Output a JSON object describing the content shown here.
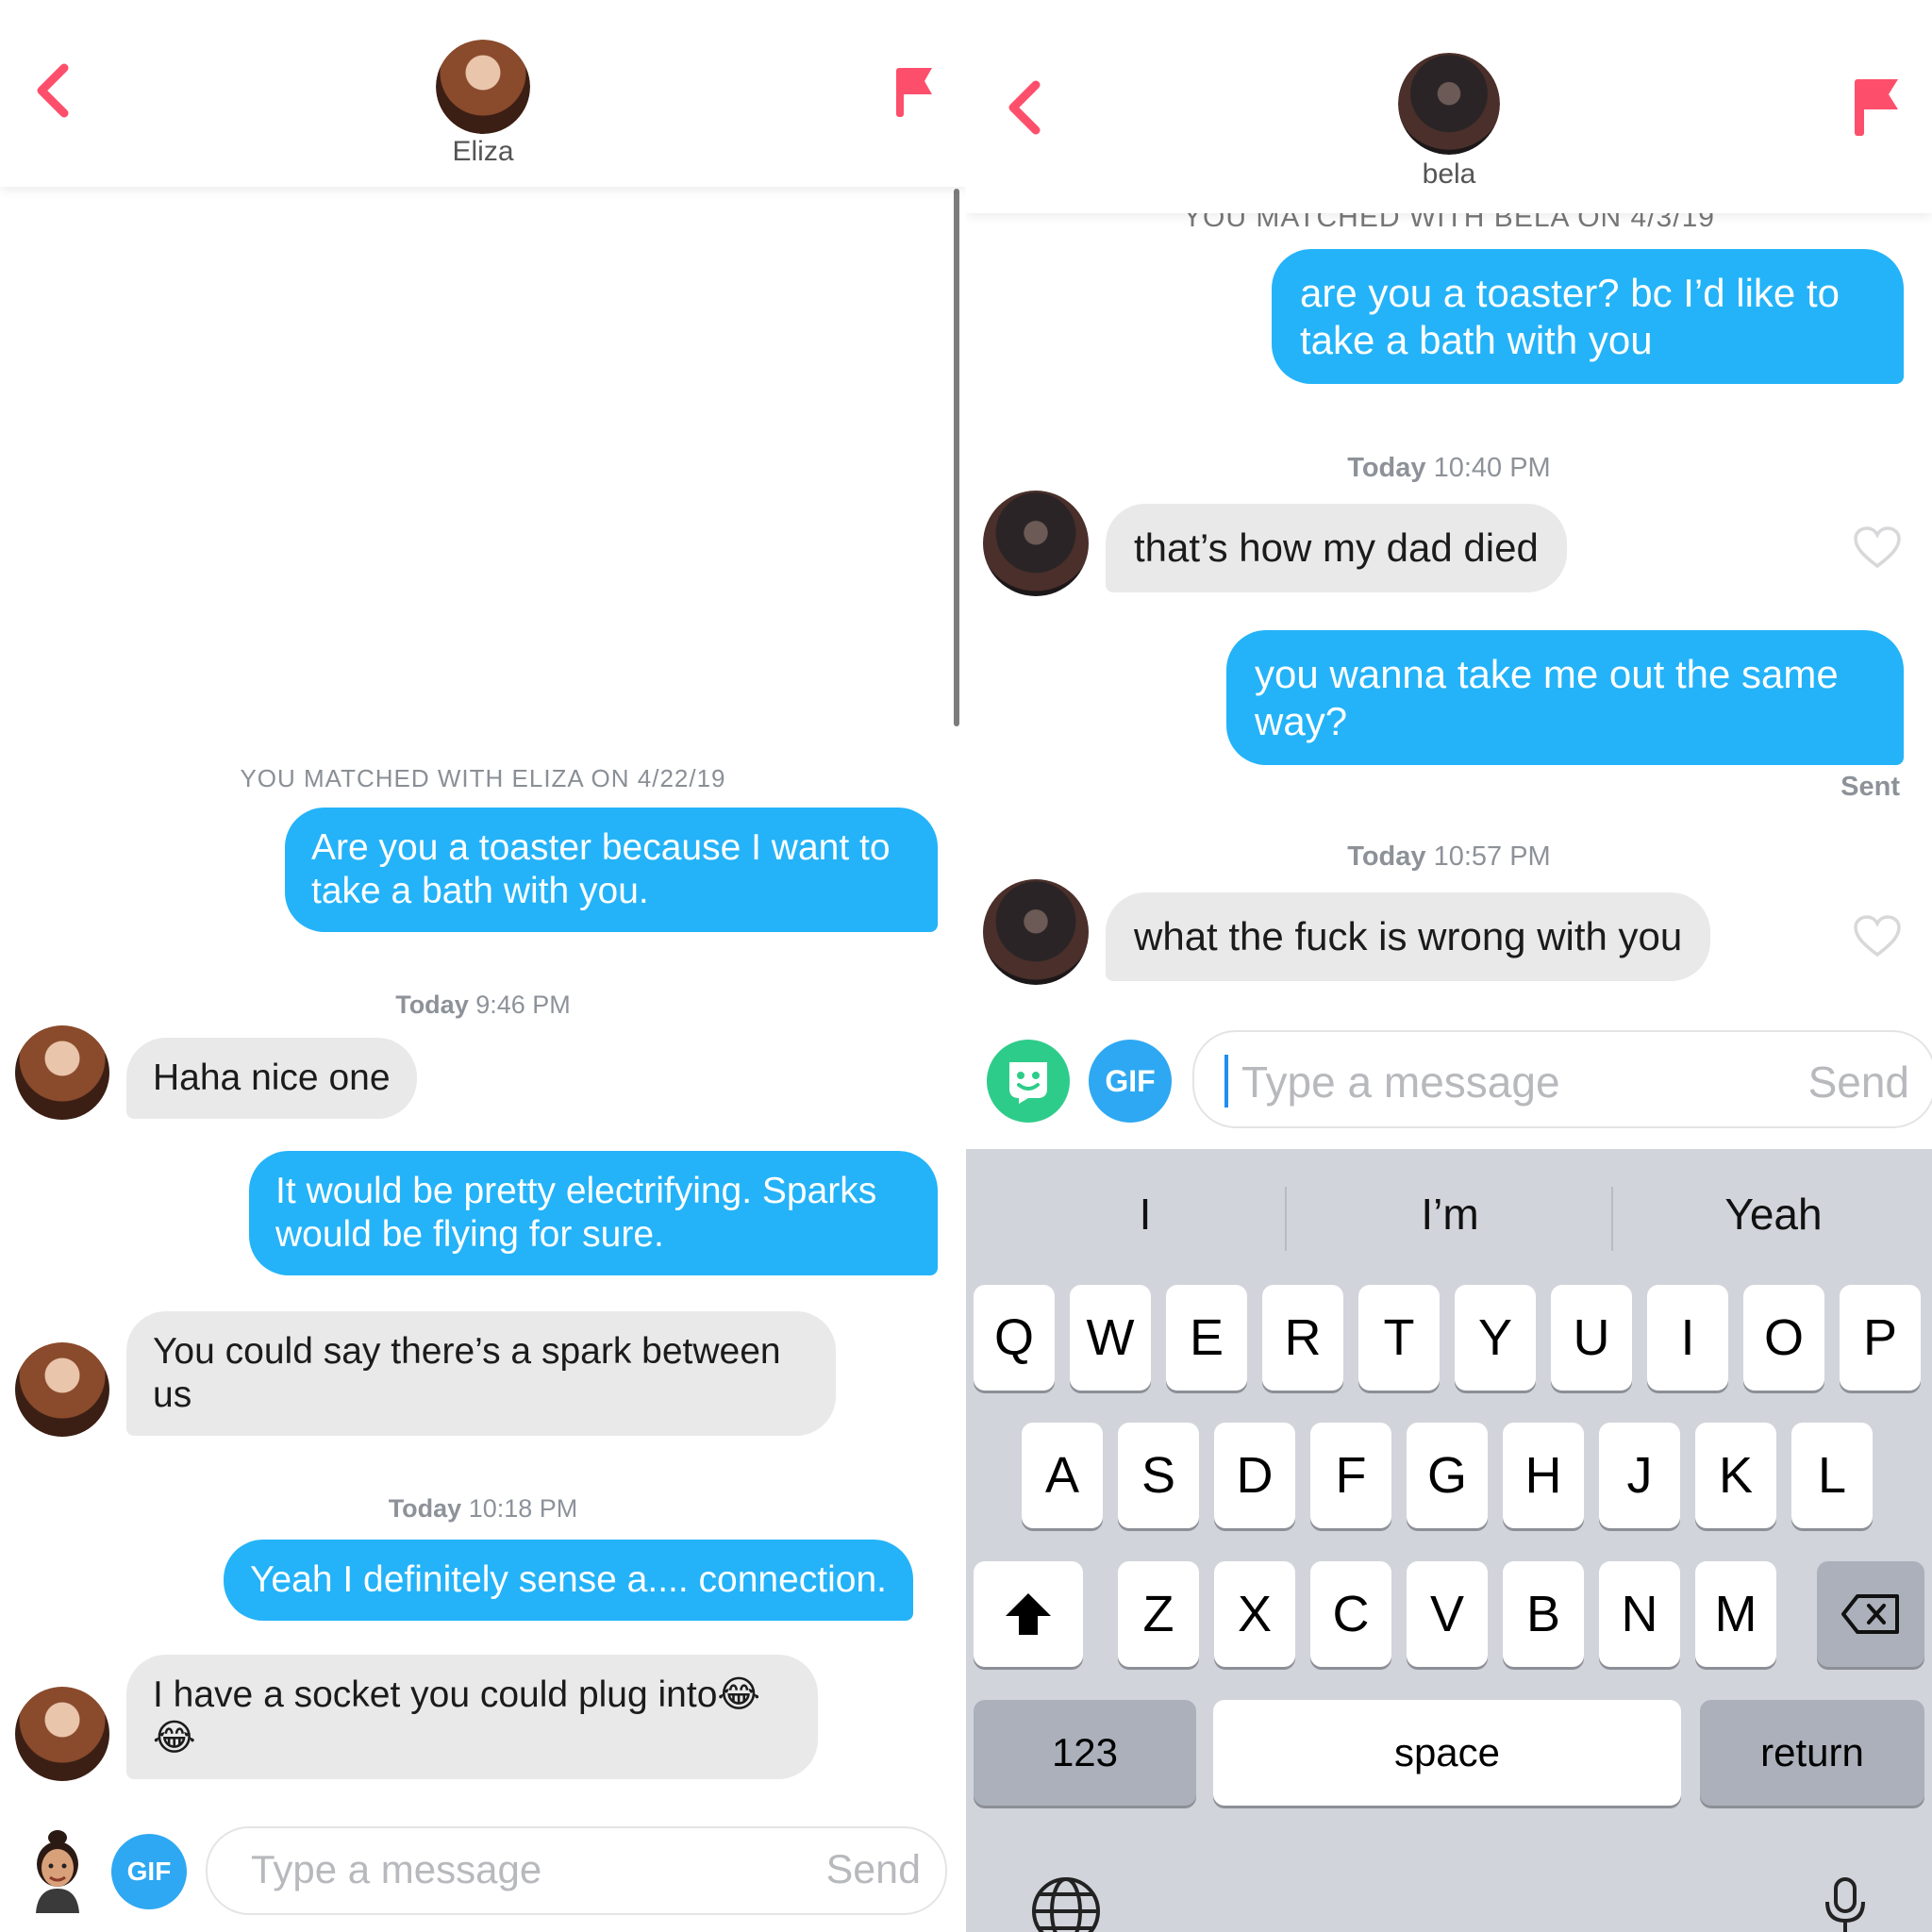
{
  "left": {
    "header": {
      "name": "Eliza"
    },
    "matched_text": "YOU MATCHED WITH ELIZA ON 4/22/19",
    "messages": [
      {
        "text": "Are you a toaster because I want to take a bath with you."
      },
      {
        "ts_day": "Today",
        "ts_time": "9:46 PM"
      },
      {
        "text": "Haha nice one"
      },
      {
        "text": "It would be pretty electrifying. Sparks would be flying for sure."
      },
      {
        "text": "You could say there’s a spark between us"
      },
      {
        "ts_day": "Today",
        "ts_time": "10:18 PM"
      },
      {
        "text": "Yeah I definitely sense a.... connection."
      },
      {
        "text": "I have a socket you could plug into😂😂"
      }
    ],
    "composer": {
      "gif": "GIF",
      "placeholder": "Type a message",
      "send": "Send"
    }
  },
  "right": {
    "header": {
      "name": "bela"
    },
    "matched_text": "YOU MATCHED WITH BELA ON 4/3/19",
    "messages": [
      {
        "text": "are you a toaster? bc I’d like to take a bath with you"
      },
      {
        "ts_day": "Today",
        "ts_time": "10:40 PM"
      },
      {
        "text": "that’s how my dad died"
      },
      {
        "text": "you wanna take me out the same way?"
      },
      {
        "status": "Sent"
      },
      {
        "ts_day": "Today",
        "ts_time": "10:57 PM"
      },
      {
        "text": "what the fuck is wrong with you"
      }
    ],
    "composer": {
      "gif": "GIF",
      "placeholder": "Type a message",
      "send": "Send"
    },
    "keyboard": {
      "suggestions": [
        "I",
        "I’m",
        "Yeah"
      ],
      "row1": [
        "Q",
        "W",
        "E",
        "R",
        "T",
        "Y",
        "U",
        "I",
        "O",
        "P"
      ],
      "row2": [
        "A",
        "S",
        "D",
        "F",
        "G",
        "H",
        "J",
        "K",
        "L"
      ],
      "row3": [
        "Z",
        "X",
        "C",
        "V",
        "B",
        "N",
        "M"
      ],
      "numbers": "123",
      "space": "space",
      "return": "return"
    }
  },
  "colors": {
    "accent_pink": "#fd4f6b",
    "bubble_blue": "#24b3f8",
    "bubble_gray": "#e9e9ea"
  }
}
